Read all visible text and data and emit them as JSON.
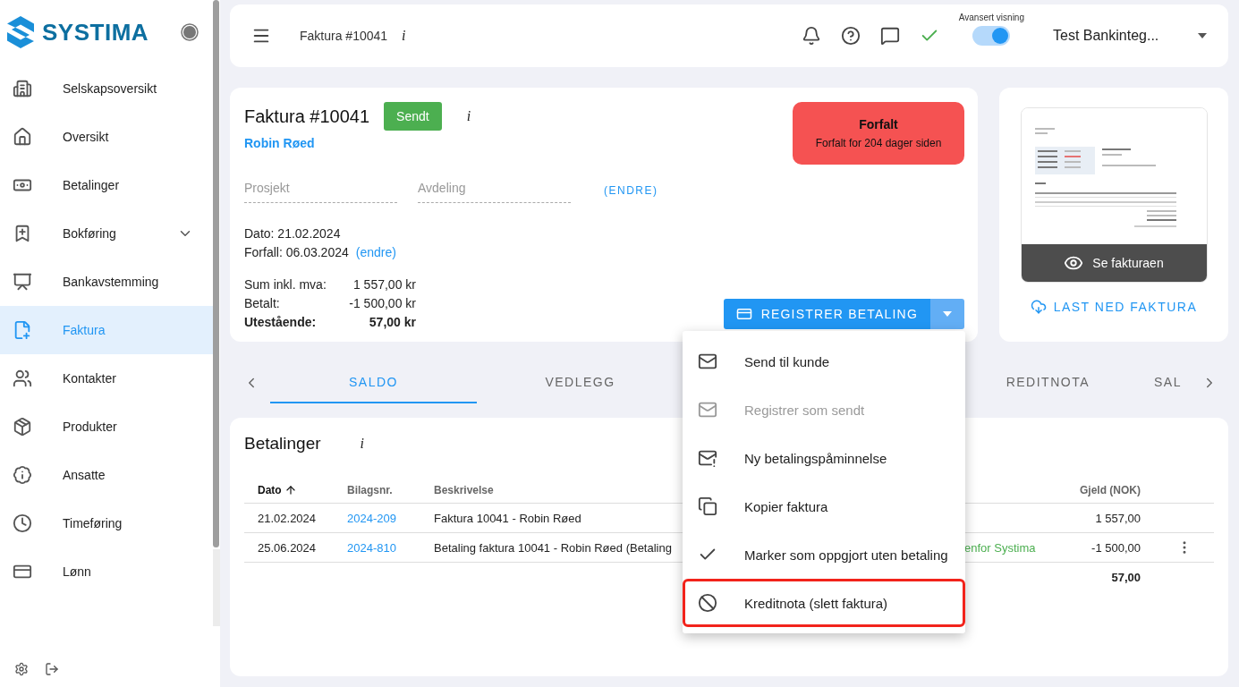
{
  "sidebar": {
    "logo_text": "SYSTIMA",
    "items": [
      {
        "label": "Selskapsoversikt",
        "selected": false,
        "expandable": false
      },
      {
        "label": "Oversikt",
        "selected": false,
        "expandable": false
      },
      {
        "label": "Betalinger",
        "selected": false,
        "expandable": false
      },
      {
        "label": "Bokføring",
        "selected": false,
        "expandable": true
      },
      {
        "label": "Bankavstemming",
        "selected": false,
        "expandable": false
      },
      {
        "label": "Faktura",
        "selected": true,
        "expandable": false
      },
      {
        "label": "Kontakter",
        "selected": false,
        "expandable": false
      },
      {
        "label": "Produkter",
        "selected": false,
        "expandable": false
      },
      {
        "label": "Ansatte",
        "selected": false,
        "expandable": false
      },
      {
        "label": "Timeføring",
        "selected": false,
        "expandable": false
      },
      {
        "label": "Lønn",
        "selected": false,
        "expandable": false
      }
    ]
  },
  "header": {
    "title": "Faktura #10041",
    "info_glyph": "i",
    "toggle_label": "Avansert visning",
    "toggle_on": true,
    "company": "Test Bankinteg..."
  },
  "invoice": {
    "title": "Faktura #10041",
    "status": "Sendt",
    "info_glyph": "i",
    "customer": "Robin Røed",
    "overdue": {
      "title": "Forfalt",
      "text": "Forfalt for 204 dager siden"
    },
    "fields": [
      {
        "placeholder": "Prosjekt"
      },
      {
        "placeholder": "Avdeling"
      }
    ],
    "change_link": "(ENDRE)",
    "date": "Dato: 21.02.2024",
    "due": "Forfall: 06.03.2024",
    "due_link": "(endre)",
    "sums": [
      {
        "label": "Sum inkl. mva:",
        "value": "1 557,00 kr",
        "bold": false
      },
      {
        "label": "Betalt:",
        "value": "-1 500,00 kr",
        "bold": false
      },
      {
        "label": "Utestående:",
        "value": "57,00 kr",
        "bold": true
      }
    ],
    "register_button": "REGISTRER BETALING"
  },
  "preview": {
    "view_button": "Se fakturaen",
    "download_link": "LAST NED FAKTURA"
  },
  "tabs": [
    {
      "label": "SALDO",
      "selected": true
    },
    {
      "label": "VEDLEGG",
      "selected": false
    },
    {
      "label": "REDITNOTA",
      "selected": false
    },
    {
      "label": "SAL",
      "selected": false
    }
  ],
  "payments": {
    "title": "Betalinger",
    "info_glyph": "i",
    "columns": [
      {
        "label": "Dato",
        "sorted": true
      },
      {
        "label": "Bilagsnr.",
        "sorted": false
      },
      {
        "label": "Beskrivelse",
        "sorted": false
      },
      {
        "label": "Gjeld (NOK)",
        "sorted": false
      }
    ],
    "rows": [
      {
        "date": "21.02.2024",
        "voucher": "2024-209",
        "description": "Faktura 10041 - Robin Røed",
        "amount": "1 557,00",
        "menu": false
      },
      {
        "date": "25.06.2024",
        "voucher": "2024-810",
        "description": "Betaling faktura 10041 - Robin Røed (Betaling",
        "column_4": "enfor Systima",
        "amount": "-1 500,00",
        "menu": true
      }
    ],
    "total": "57,00"
  },
  "menu": {
    "items": [
      {
        "label": "Send til kunde",
        "disabled": false,
        "outlined": false
      },
      {
        "label": "Registrer som sendt",
        "disabled": true,
        "outlined": false
      },
      {
        "label": "Ny betalingspåminnelse",
        "disabled": false,
        "outlined": false
      },
      {
        "label": "Kopier faktura",
        "disabled": false,
        "outlined": false
      },
      {
        "label": "Marker som oppgjort uten betaling",
        "disabled": false,
        "outlined": false
      },
      {
        "label": "Kreditnota (slett faktura)",
        "disabled": false,
        "outlined": true
      }
    ]
  }
}
